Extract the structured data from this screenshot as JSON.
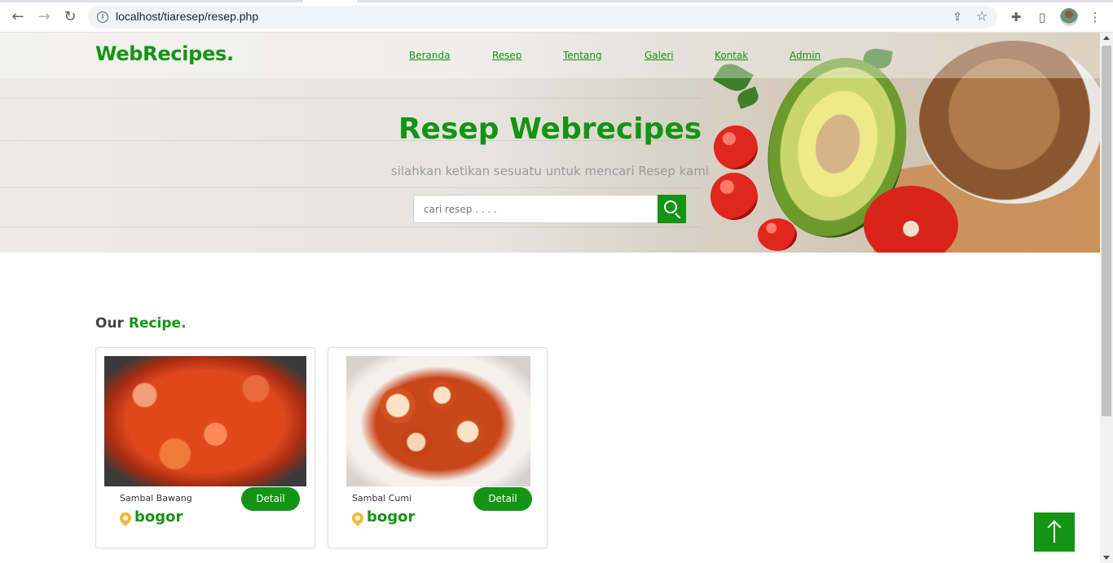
{
  "browser": {
    "url": "localhost/tiaresep/resep.php"
  },
  "site": {
    "logo": "WebRecipes.",
    "menu": [
      "Beranda",
      "Resep",
      "Tentang",
      "Galeri",
      "Kontak",
      "Admin"
    ]
  },
  "hero": {
    "title": "Resep Webrecipes",
    "subtitle": "silahkan ketikan sesuatu untuk mencari Resep kami",
    "search_placeholder": "cari resep . . . ."
  },
  "recipes_section": {
    "title_prefix": "Our ",
    "title_accent": "Recipe."
  },
  "recipes": [
    {
      "name": "Sambal Bawang",
      "location": "bogor",
      "button": "Detail"
    },
    {
      "name": "Sambal Cumi",
      "location": "bogor",
      "button": "Detail"
    }
  ],
  "colors": {
    "brand_green": "#149414",
    "pin_yellow": "#f5b82e"
  }
}
